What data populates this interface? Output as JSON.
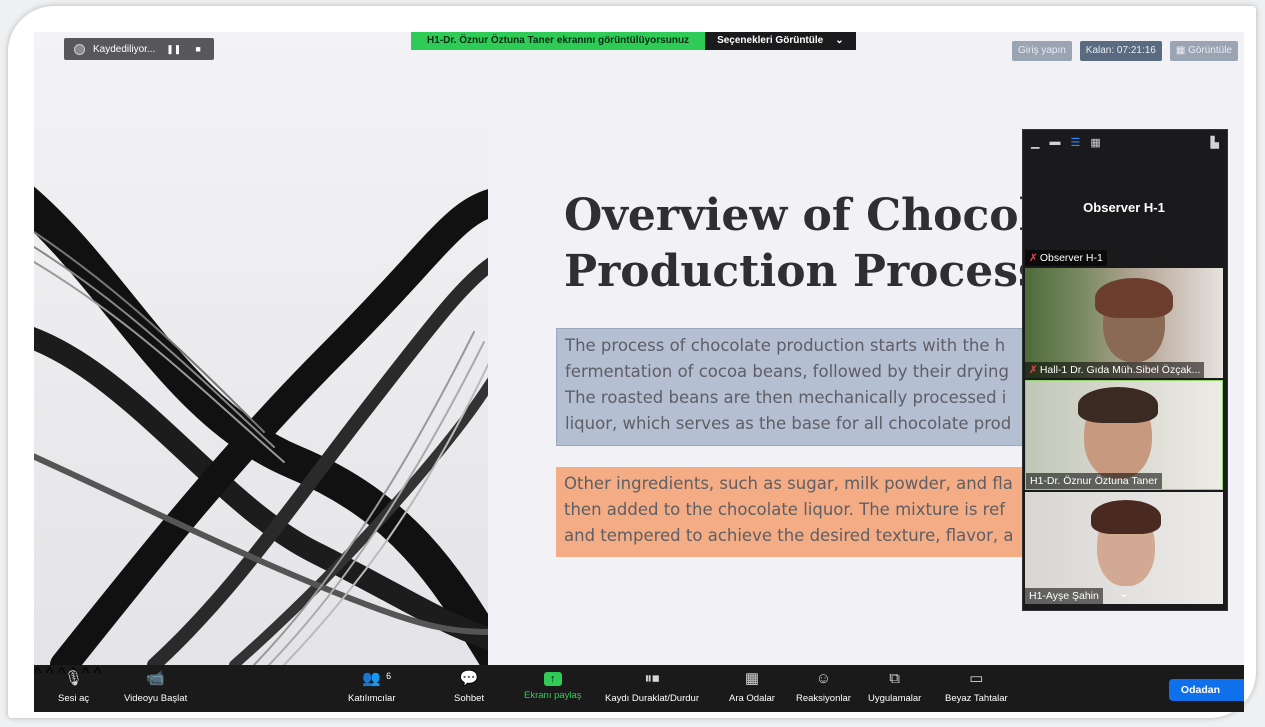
{
  "recording": {
    "label": "Kaydediliyor..."
  },
  "share_banner": {
    "text": "H1-Dr. Öznur Öztuna Taner ekranını görüntülüyorsunuz",
    "options": "Seçenekleri Görüntüle"
  },
  "top_right": {
    "login": "Giriş yapın",
    "remaining": "Kalan: 07:21:16",
    "view": "Görüntüle"
  },
  "slide": {
    "title_line1": "Overview of Chocolat",
    "title_line2": "Production Process",
    "para1": "The process of chocolate production starts with the h\nfermentation of cocoa beans, followed by their drying\nThe roasted beans are then mechanically processed i\nliquor, which serves as the base for all chocolate prod",
    "para2": "Other ingredients, such as sugar, milk powder, and fla\nthen added to the chocolate liquor. The mixture is ref\nand tempered to achieve the desired texture, flavor, a"
  },
  "gallery": {
    "observer_big": "Observer H-1",
    "observer_label": "Observer H-1",
    "participant1": "Hall-1 Dr. Gıda Müh.Sibel Özçak...",
    "participant2": "H1-Dr. Öznur Öztuna Taner",
    "participant3": "H1-Ayşe Şahin"
  },
  "toolbar": {
    "mute": "Sesi aç",
    "video": "Videoyu Başlat",
    "participants": "Katılımcılar",
    "participants_count": "6",
    "chat": "Sohbet",
    "share": "Ekranı paylaş",
    "record": "Kaydı Duraklat/Durdur",
    "breakout": "Ara Odalar",
    "reactions": "Reaksiyonlar",
    "apps": "Uygulamalar",
    "whiteboards": "Beyaz Tahtalar",
    "leave": "Odadan"
  },
  "colors": {
    "accent_green": "#2ecc57",
    "accent_blue": "#0e71eb",
    "para1_bg": "#b4bfd2",
    "para2_bg": "#f3ac83"
  }
}
